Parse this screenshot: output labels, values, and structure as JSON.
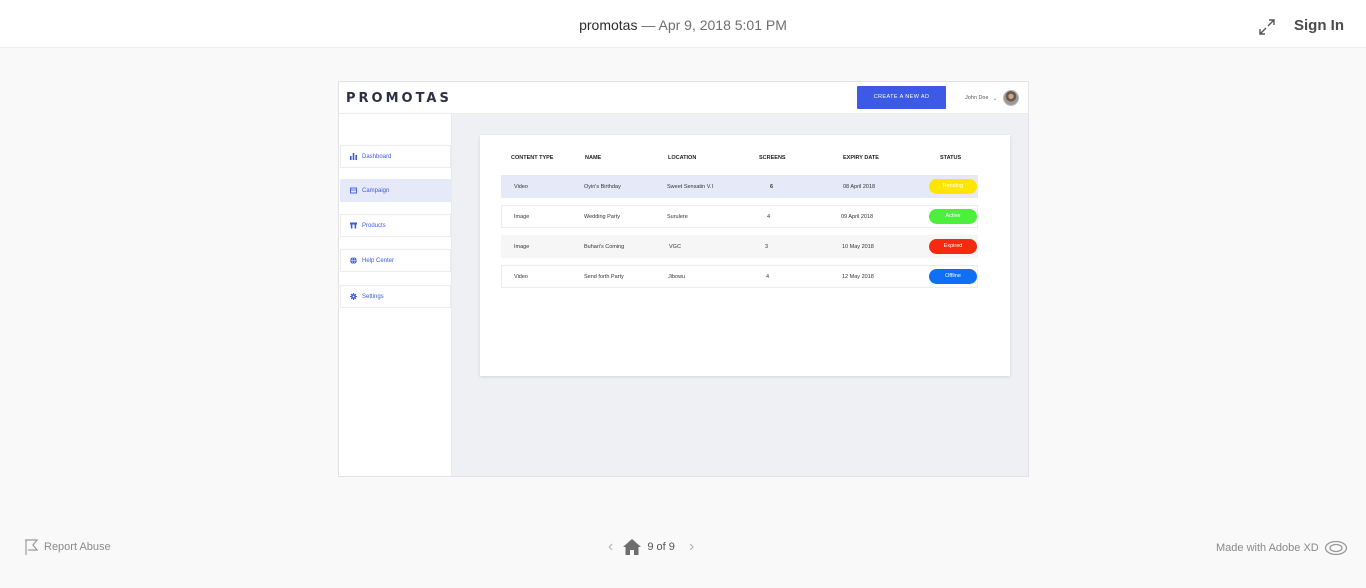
{
  "viewer": {
    "project_name": "promotas",
    "timestamp": "— Apr 9, 2018 5:01 PM",
    "sign_in_label": "Sign In",
    "report_label": "Report Abuse",
    "page_indicator": "9 of 9",
    "made_with_label": "Made with Adobe XD",
    "prev_arrow": "‹",
    "next_arrow": "›"
  },
  "app": {
    "logo": "PROMOTAS",
    "create_button_label": "CREATE A NEW AD",
    "user_name": "John Doe",
    "user_chevron": "⌄",
    "accent_color": "#3d5ae6",
    "sidebar": [
      {
        "label": "Dashboard",
        "icon": "bar-chart-icon"
      },
      {
        "label": "Campaign",
        "icon": "envelope-icon",
        "active": true
      },
      {
        "label": "Products",
        "icon": "shop-icon"
      },
      {
        "label": "Help Center",
        "icon": "globe-icon"
      },
      {
        "label": "Settings",
        "icon": "gear-icon"
      }
    ],
    "table": {
      "headers": [
        "CONTENT TYPE",
        "NAME",
        "LOCATION",
        "SCREENS",
        "EXPIRY DATE",
        "STATUS"
      ],
      "rows": [
        {
          "content_type": "Video",
          "name": "Oyin's Birthday",
          "location": "Sweet Sensatin V.I",
          "screens": "6",
          "expiry": "08 April 2018",
          "status": "Pending",
          "status_color": "#ffe600"
        },
        {
          "content_type": "Image",
          "name": "Wedding Party",
          "location": "Surulere",
          "screens": "4",
          "expiry": "09 April 2018",
          "status": "Active",
          "status_color": "#4cf03c"
        },
        {
          "content_type": "Image",
          "name": "Buhari's Coming",
          "location": "VGC",
          "screens": "3",
          "expiry": "10 May 2018",
          "status": "Expired",
          "status_color": "#f52a0e"
        },
        {
          "content_type": "Video",
          "name": "Send forth Party",
          "location": "Jibowu",
          "screens": "4",
          "expiry": "12 May 2018",
          "status": "Offline",
          "status_color": "#0f6ff5"
        }
      ]
    }
  }
}
